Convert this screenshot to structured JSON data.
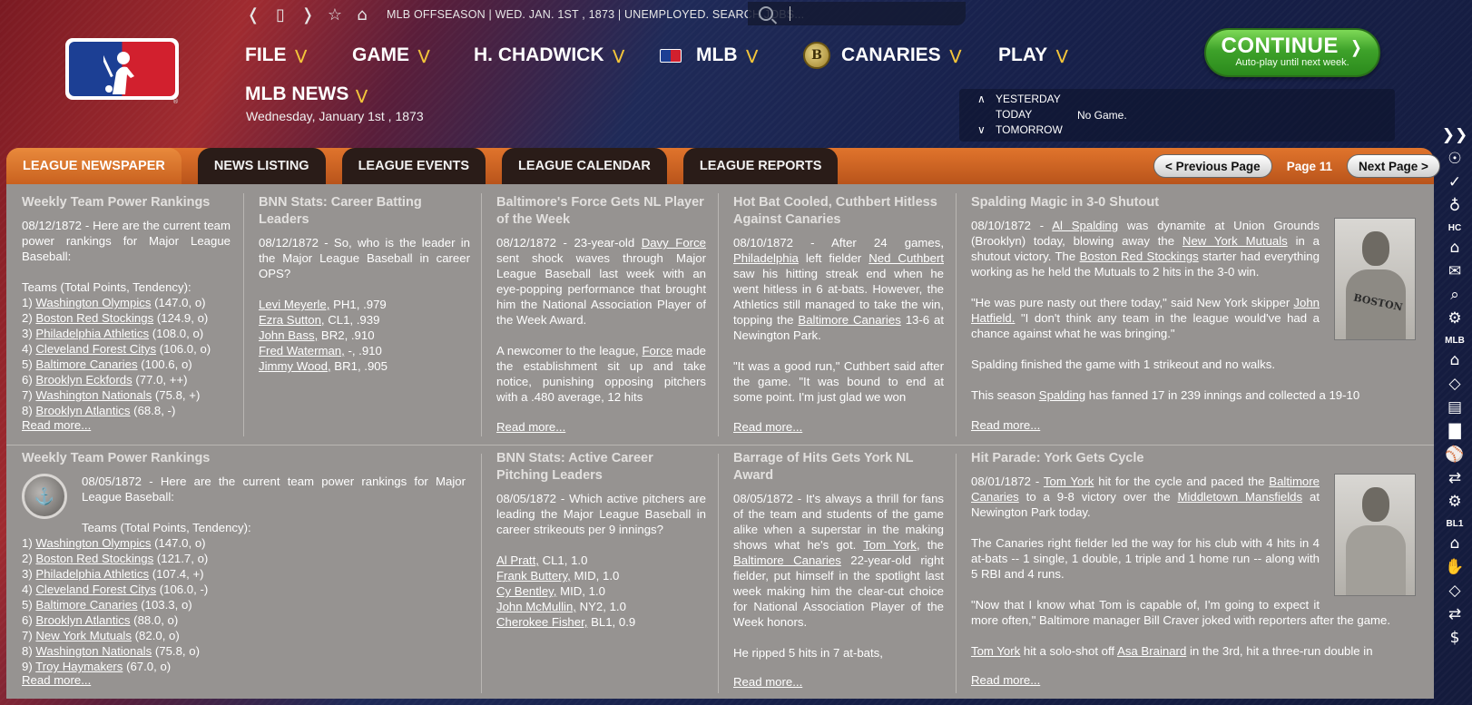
{
  "topbar": {
    "status": "MLB OFFSEASON  |  WED. JAN. 1ST , 1873  |  UNEMPLOYED. SEARCH JOBS...",
    "icons": [
      "back-icon",
      "bookmark-icon",
      "forward-icon",
      "star-icon",
      "home-icon"
    ]
  },
  "menu": {
    "file": "FILE",
    "game": "GAME",
    "manager": "H. CHADWICK",
    "league": "MLB",
    "team": "CANARIES",
    "play": "PLAY"
  },
  "page": {
    "title": "MLB NEWS",
    "date": "Wednesday, January 1st , 1873"
  },
  "schedule": {
    "yesterday": "YESTERDAY",
    "today": "TODAY",
    "tomorrow": "TOMORROW",
    "today_result": "No Game."
  },
  "continue": {
    "label": "CONTINUE",
    "sub": "Auto-play until next week."
  },
  "tabs": [
    "LEAGUE NEWSPAPER",
    "NEWS LISTING",
    "LEAGUE EVENTS",
    "LEAGUE CALENDAR",
    "LEAGUE REPORTS"
  ],
  "pager": {
    "prev": "< Previous Page",
    "page": "Page 11",
    "next": "Next Page >"
  },
  "read_more": "Read more...",
  "articles": {
    "a1": {
      "title": "Weekly Team Power Rankings",
      "intro": "08/12/1872 - Here are the current team power rankings for Major League Baseball:",
      "subhead": "Teams (Total Points, Tendency):",
      "items": [
        {
          "n": "1)",
          "team": "Washington Olympics",
          "val": "(147.0, o)"
        },
        {
          "n": "2)",
          "team": "Boston Red Stockings",
          "val": "(124.9, o)"
        },
        {
          "n": "3)",
          "team": "Philadelphia Athletics",
          "val": "(108.0, o)"
        },
        {
          "n": "4)",
          "team": "Cleveland Forest Citys",
          "val": "(106.0, o)"
        },
        {
          "n": "5)",
          "team": "Baltimore Canaries",
          "val": "(100.6, o)"
        },
        {
          "n": "6)",
          "team": "Brooklyn Eckfords",
          "val": "(77.0, ++)"
        },
        {
          "n": "7)",
          "team": "Washington Nationals",
          "val": "(75.8, +)"
        },
        {
          "n": "8)",
          "team": "Brooklyn Atlantics",
          "val": "(68.8, -)"
        }
      ]
    },
    "a2": {
      "title": "BNN Stats: Career Batting Leaders",
      "intro": "08/12/1872 - So, who is the leader in the Major League Baseball in career OPS?",
      "items": [
        {
          "name": "Levi Meyerle,",
          "val": " PH1, .979"
        },
        {
          "name": "Ezra Sutton,",
          "val": " CL1, .939"
        },
        {
          "name": "John Bass,",
          "val": " BR2, .910"
        },
        {
          "name": "Fred Waterman,",
          "val": " -, .910"
        },
        {
          "name": "Jimmy Wood,",
          "val": " BR1, .905"
        }
      ]
    },
    "a3": {
      "title": "Baltimore's Force Gets NL Player of the Week",
      "p1a": "08/12/1872 - 23-year-old ",
      "p1link": "Davy Force",
      "p1b": " sent shock waves through Major League Baseball last week with an eye-popping performance that brought him the National Association Player of the Week Award.",
      "p2a": "A newcomer to the league, ",
      "p2link": "Force",
      "p2b": " made the establishment sit up and take notice, punishing opposing pitchers with a .480 average, 12 hits"
    },
    "a4": {
      "title": "Hot Bat Cooled, Cuthbert Hitless Against Canaries",
      "p1a": "08/10/1872 - After 24 games, ",
      "p1l1": "Philadelphia",
      "p1b": " left fielder ",
      "p1l2": "Ned Cuthbert",
      "p1c": " saw his hitting streak end when he went hitless in 6 at-bats. However, the Athletics still managed to take the win, topping the ",
      "p1l3": "Baltimore Canaries",
      "p1d": " 13-6 at Newington Park.",
      "p2": "\"It was a good run,\" Cuthbert said after the game. \"It was bound to end at some point. I'm just glad we won"
    },
    "a5": {
      "title": "Spalding Magic in 3-0 Shutout",
      "p1a": "08/10/1872 - ",
      "p1l1": "Al Spalding",
      "p1b": " was dynamite at Union Grounds (Brooklyn) today, blowing away the ",
      "p1l2": "New York Mutuals",
      "p1c": " in a shutout victory. The ",
      "p1l3": "Boston Red Stockings",
      "p1d": " starter had everything working as he held the Mutuals to 2 hits in the 3-0 win.",
      "p2a": "\"He was pure nasty out there today,\" said New York skipper ",
      "p2l": "John Hatfield.",
      "p2b": " \"I don't think any team in the league would've had a chance against what he was bringing.\"",
      "p3": "Spalding finished the game with 1 strikeout and no walks.",
      "p4a": "This season ",
      "p4l": "Spalding",
      "p4b": " has fanned 17 in 239 innings and collected a 19-10",
      "photo_text": "BOSTON"
    },
    "b1": {
      "title": "Weekly Team Power Rankings",
      "intro": "08/05/1872 - Here are the current team power rankings for Major League Baseball:",
      "subhead": "Teams (Total Points, Tendency):",
      "items": [
        {
          "n": "1)",
          "team": "Washington Olympics",
          "val": "(147.0, o)"
        },
        {
          "n": "2)",
          "team": "Boston Red Stockings",
          "val": "(121.7, o)"
        },
        {
          "n": "3)",
          "team": "Philadelphia Athletics",
          "val": "(107.4, +)"
        },
        {
          "n": "4)",
          "team": "Cleveland Forest Citys",
          "val": "(106.0, -)"
        },
        {
          "n": "5)",
          "team": "Baltimore Canaries",
          "val": "(103.3, o)"
        },
        {
          "n": "6)",
          "team": "Brooklyn Atlantics",
          "val": "(88.0, o)"
        },
        {
          "n": "7)",
          "team": "New York Mutuals",
          "val": "(82.0, o)"
        },
        {
          "n": "8)",
          "team": "Washington Nationals",
          "val": "(75.8, o)"
        },
        {
          "n": "9)",
          "team": "Troy Haymakers",
          "val": "(67.0, o)"
        }
      ]
    },
    "b2": {
      "title": "BNN Stats: Active Career Pitching Leaders",
      "intro": "08/05/1872 - Which active pitchers are leading the Major League Baseball in career strikeouts per 9 innings?",
      "items": [
        {
          "name": "Al Pratt,",
          "val": " CL1, 1.0"
        },
        {
          "name": "Frank Buttery,",
          "val": " MID, 1.0"
        },
        {
          "name": "Cy Bentley,",
          "val": " MID, 1.0"
        },
        {
          "name": "John McMullin,",
          "val": " NY2, 1.0"
        },
        {
          "name": "Cherokee Fisher,",
          "val": " BL1, 0.9"
        }
      ]
    },
    "b3": {
      "title": "Barrage of Hits Gets York NL Award",
      "p1a": "08/05/1872 - It's always a thrill for fans of the team and students of the game alike when a superstar in the making shows what he's got. ",
      "p1l1": "Tom York",
      "p1b": ", the ",
      "p1l2": "Baltimore Canaries",
      "p1c": " 22-year-old right fielder, put himself in the spotlight last week making him the clear-cut choice for National Association Player of the Week honors.",
      "p2": "He ripped 5 hits in 7 at-bats,"
    },
    "b4": {
      "title": "Hit Parade: York Gets Cycle",
      "p1a": "08/01/1872 - ",
      "p1l1": "Tom York",
      "p1b": " hit for the cycle and paced the ",
      "p1l2": "Baltimore Canaries",
      "p1c": " to a 9-8 victory over the ",
      "p1l3": "Middletown Mansfields",
      "p1d": " at Newington Park today.",
      "p2": "The Canaries right fielder led the way for his club with 4 hits in 4 at-bats -- 1 single, 1 double, 1 triple and 1 home run -- along with 5 RBI and 4 runs.",
      "p3": "\"Now that I know what Tom is capable of, I'm going to expect it more often,\" Baltimore manager Bill Craver joked with reporters after the game.",
      "p4l1": "Tom York",
      "p4a": " hit a solo-shot off ",
      "p4l2": "Asa Brainard",
      "p4b": " in the 3rd, hit a three-run double in"
    }
  },
  "rail": {
    "hc": "HC",
    "mlb": "MLB",
    "bl1": "BL1"
  },
  "colors": {
    "accent_orange": "#d8692a",
    "continue_green": "#3ea22a",
    "panel_gray": "#969391",
    "menu_chevron": "#f2c43a"
  }
}
